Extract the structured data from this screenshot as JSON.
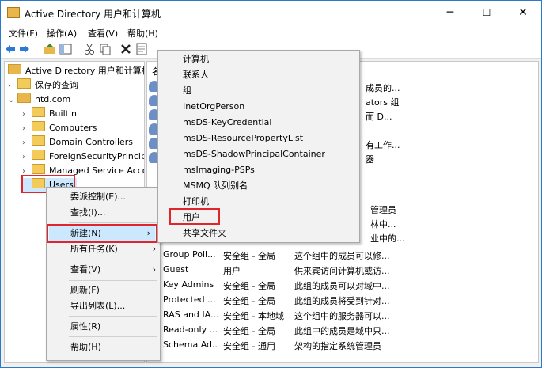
{
  "window": {
    "title": "Active Directory 用户和计算机",
    "minimize": "─",
    "maximize": "☐",
    "close": "✕"
  },
  "menu": [
    "文件(F)",
    "操作(A)",
    "查看(V)",
    "帮助(H)"
  ],
  "tree": {
    "root": "Active Directory 用户和计算机",
    "saved_queries": "保存的查询",
    "domain": "ntd.com",
    "children": [
      "Builtin",
      "Computers",
      "Domain Controllers",
      "ForeignSecurityPrincipa",
      "Managed Service Acco",
      "Users"
    ]
  },
  "list": {
    "header": "名",
    "partial_rows": [
      {
        "desc": "成员的..."
      },
      {
        "desc": "ators 组"
      },
      {
        "desc": "而 D..."
      },
      {
        "desc": ""
      },
      {
        "desc": "有工作..."
      },
      {
        "desc": "器"
      },
      {
        "desc": ""
      },
      {
        "desc": "管理员"
      },
      {
        "desc": "林中..."
      },
      {
        "desc": "业中的..."
      }
    ],
    "rows": [
      {
        "name": "Group Poli...",
        "type": "安全组 - 全局",
        "desc": "这个组中的成员可以修..."
      },
      {
        "name": "Guest",
        "type": "用户",
        "desc": "供来宾访问计算机或访..."
      },
      {
        "name": "Key Admins",
        "type": "安全组 - 全局",
        "desc": "此组的成员可以对域中..."
      },
      {
        "name": "Protected ...",
        "type": "安全组 - 全局",
        "desc": "此组的成员将受到针对..."
      },
      {
        "name": "RAS and IA...",
        "type": "安全组 - 本地域",
        "desc": "这个组中的服务器可以..."
      },
      {
        "name": "Read-only ...",
        "type": "安全组 - 全局",
        "desc": "此组中的成员是域中只..."
      },
      {
        "name": "Schema Ad...",
        "type": "安全组 - 通用",
        "desc": "架构的指定系统管理员"
      }
    ]
  },
  "context_menu": {
    "items": [
      "委派控制(E)...",
      "查找(I)...",
      "新建(N)",
      "所有任务(K)",
      "查看(V)",
      "刷新(F)",
      "导出列表(L)...",
      "属性(R)",
      "帮助(H)"
    ],
    "chevron": "›"
  },
  "submenu": {
    "items": [
      "计算机",
      "联系人",
      "组",
      "InetOrgPerson",
      "msDS-KeyCredential",
      "msDS-ResourcePropertyList",
      "msDS-ShadowPrincipalContainer",
      "msImaging-PSPs",
      "MSMQ 队列别名",
      "打印机",
      "用户",
      "共享文件夹"
    ]
  },
  "colors": {
    "highlight": "#e0262b",
    "selected": "#cce8ff",
    "border": "#2b79c9"
  }
}
